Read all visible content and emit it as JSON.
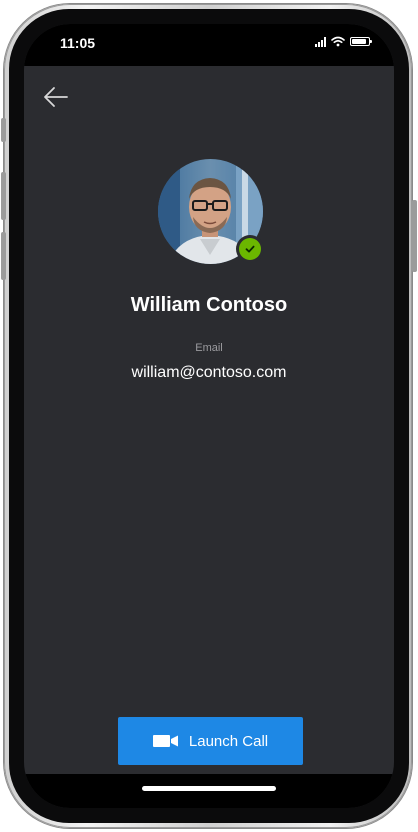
{
  "status_bar": {
    "time": "11:05",
    "icons": [
      "signal-icon",
      "wifi-icon",
      "battery-icon"
    ]
  },
  "header": {
    "back_icon": "arrow-left-icon"
  },
  "profile": {
    "avatar_icon": "user-photo",
    "presence_icon": "available-check-icon",
    "presence_color": "#6bb700",
    "name": "William Contoso",
    "email_label": "Email",
    "email": "william@contoso.com"
  },
  "actions": {
    "launch_call_label": "Launch Call",
    "launch_call_icon": "video-camera-icon",
    "accent_color": "#1e88e5"
  },
  "colors": {
    "screen_background": "#2b2c30",
    "status_bar_background": "#000000",
    "muted_text": "#9b9b9f"
  }
}
